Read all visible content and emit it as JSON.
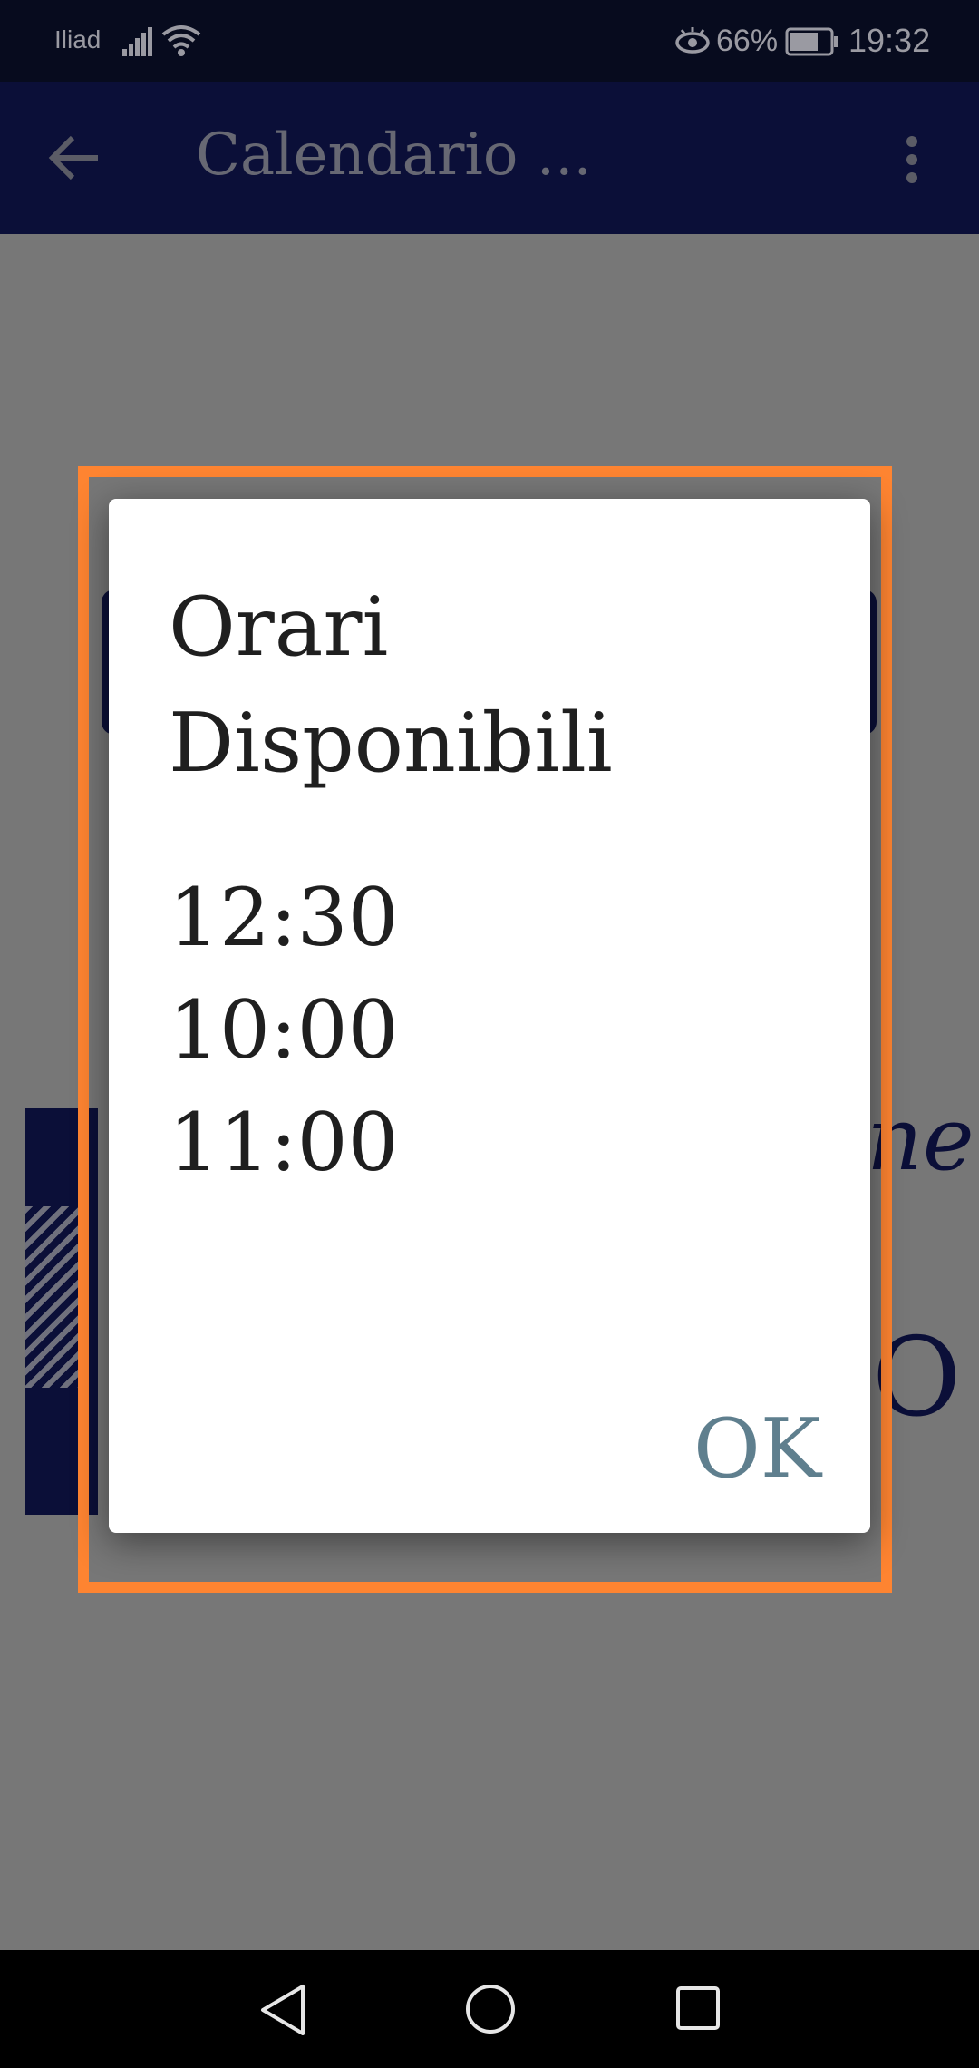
{
  "status_bar": {
    "carrier": "Iliad",
    "battery_percent": "66%",
    "time": "19:32",
    "icons": [
      "signal-icon",
      "wifi-icon",
      "eye-comfort-icon",
      "battery-icon"
    ]
  },
  "app_bar": {
    "title": "Calendario ...",
    "back_icon": "arrow-left-icon",
    "menu_icon": "more-vertical-icon"
  },
  "dialog": {
    "title": "Orari Disponibili",
    "times": [
      "12:30",
      "10:00",
      "11:00"
    ],
    "ok_label": "OK"
  },
  "background": {
    "text_fragment_1": "ne",
    "text_fragment_2": "O"
  },
  "nav_bar": {
    "icons": [
      "nav-back-icon",
      "nav-home-icon",
      "nav-recents-icon"
    ]
  },
  "colors": {
    "primary_dark": "#0b0f38",
    "highlight": "#fe8431",
    "ok_button": "#5f7f8e",
    "scrim": "#777777"
  }
}
